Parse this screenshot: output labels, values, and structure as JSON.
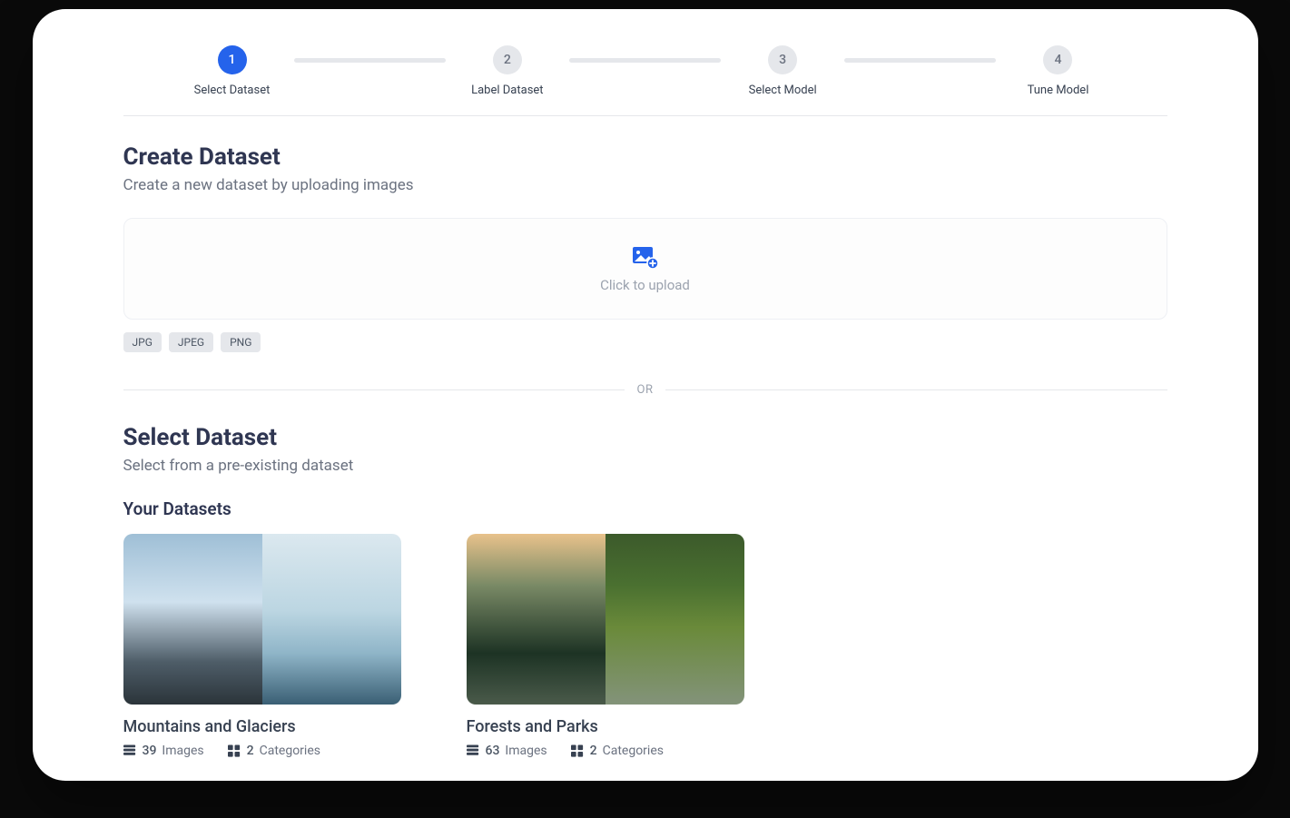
{
  "stepper": {
    "steps": [
      {
        "num": "1",
        "label": "Select Dataset",
        "active": true
      },
      {
        "num": "2",
        "label": "Label Dataset",
        "active": false
      },
      {
        "num": "3",
        "label": "Select Model",
        "active": false
      },
      {
        "num": "4",
        "label": "Tune Model",
        "active": false
      }
    ]
  },
  "create": {
    "title": "Create Dataset",
    "subtitle": "Create a new dataset by uploading images",
    "upload_label": "Click to upload",
    "formats": [
      "JPG",
      "JPEG",
      "PNG"
    ]
  },
  "divider_or": "OR",
  "select": {
    "title": "Select Dataset",
    "subtitle": "Select from a pre-existing dataset"
  },
  "your_datasets": {
    "heading": "Your Datasets",
    "items": [
      {
        "name": "Mountains and Glaciers",
        "images": "39",
        "images_label": "Images",
        "categories": "2",
        "categories_label": "Categories"
      },
      {
        "name": "Forests and Parks",
        "images": "63",
        "images_label": "Images",
        "categories": "2",
        "categories_label": "Categories"
      }
    ]
  }
}
